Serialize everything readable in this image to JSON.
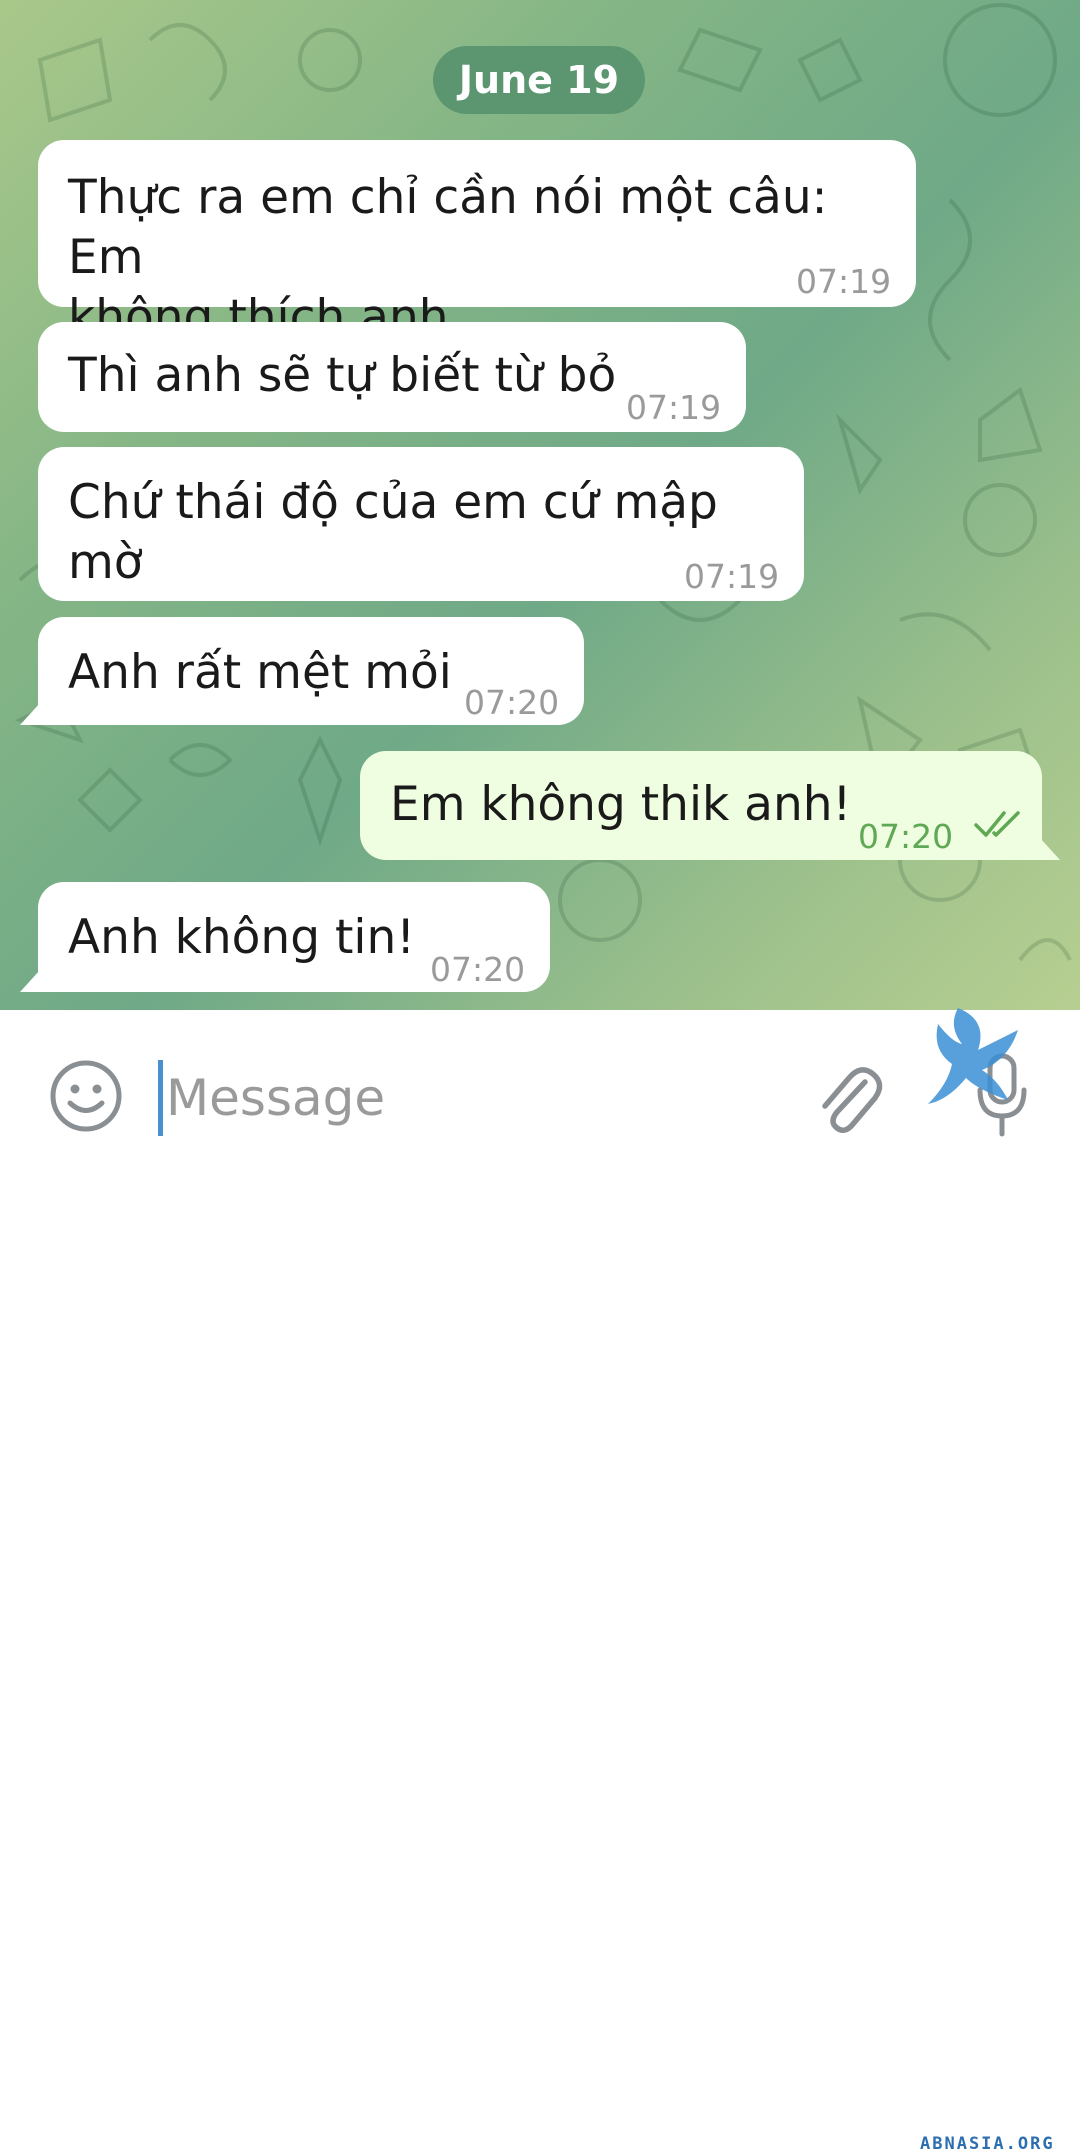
{
  "date_header": "June 19",
  "messages": [
    {
      "line1": "Thực ra em chỉ cần nói một câu: Em",
      "line2": "không thích anh",
      "time": "07:19",
      "direction": "in"
    },
    {
      "text": "Thì anh sẽ tự biết từ bỏ",
      "time": "07:19",
      "direction": "in"
    },
    {
      "text": "Chứ thái độ của em cứ mập mờ",
      "time": "07:19",
      "direction": "in"
    },
    {
      "text": "Anh rất mệt mỏi",
      "time": "07:20",
      "direction": "in"
    },
    {
      "text": "Em không thik anh!",
      "time": "07:20",
      "direction": "out",
      "status": "read"
    },
    {
      "text": "Anh không tin!",
      "time": "07:20",
      "direction": "in"
    }
  ],
  "composer": {
    "placeholder": "Message",
    "icons": [
      "emoji-icon",
      "attach-icon",
      "microphone-icon"
    ]
  },
  "watermark": "ABNASIA.ORG",
  "colors": {
    "incoming_bubble": "#ffffff",
    "outgoing_bubble": "#effde0",
    "date_pill": "#5b9670",
    "read_check": "#5fa855"
  }
}
